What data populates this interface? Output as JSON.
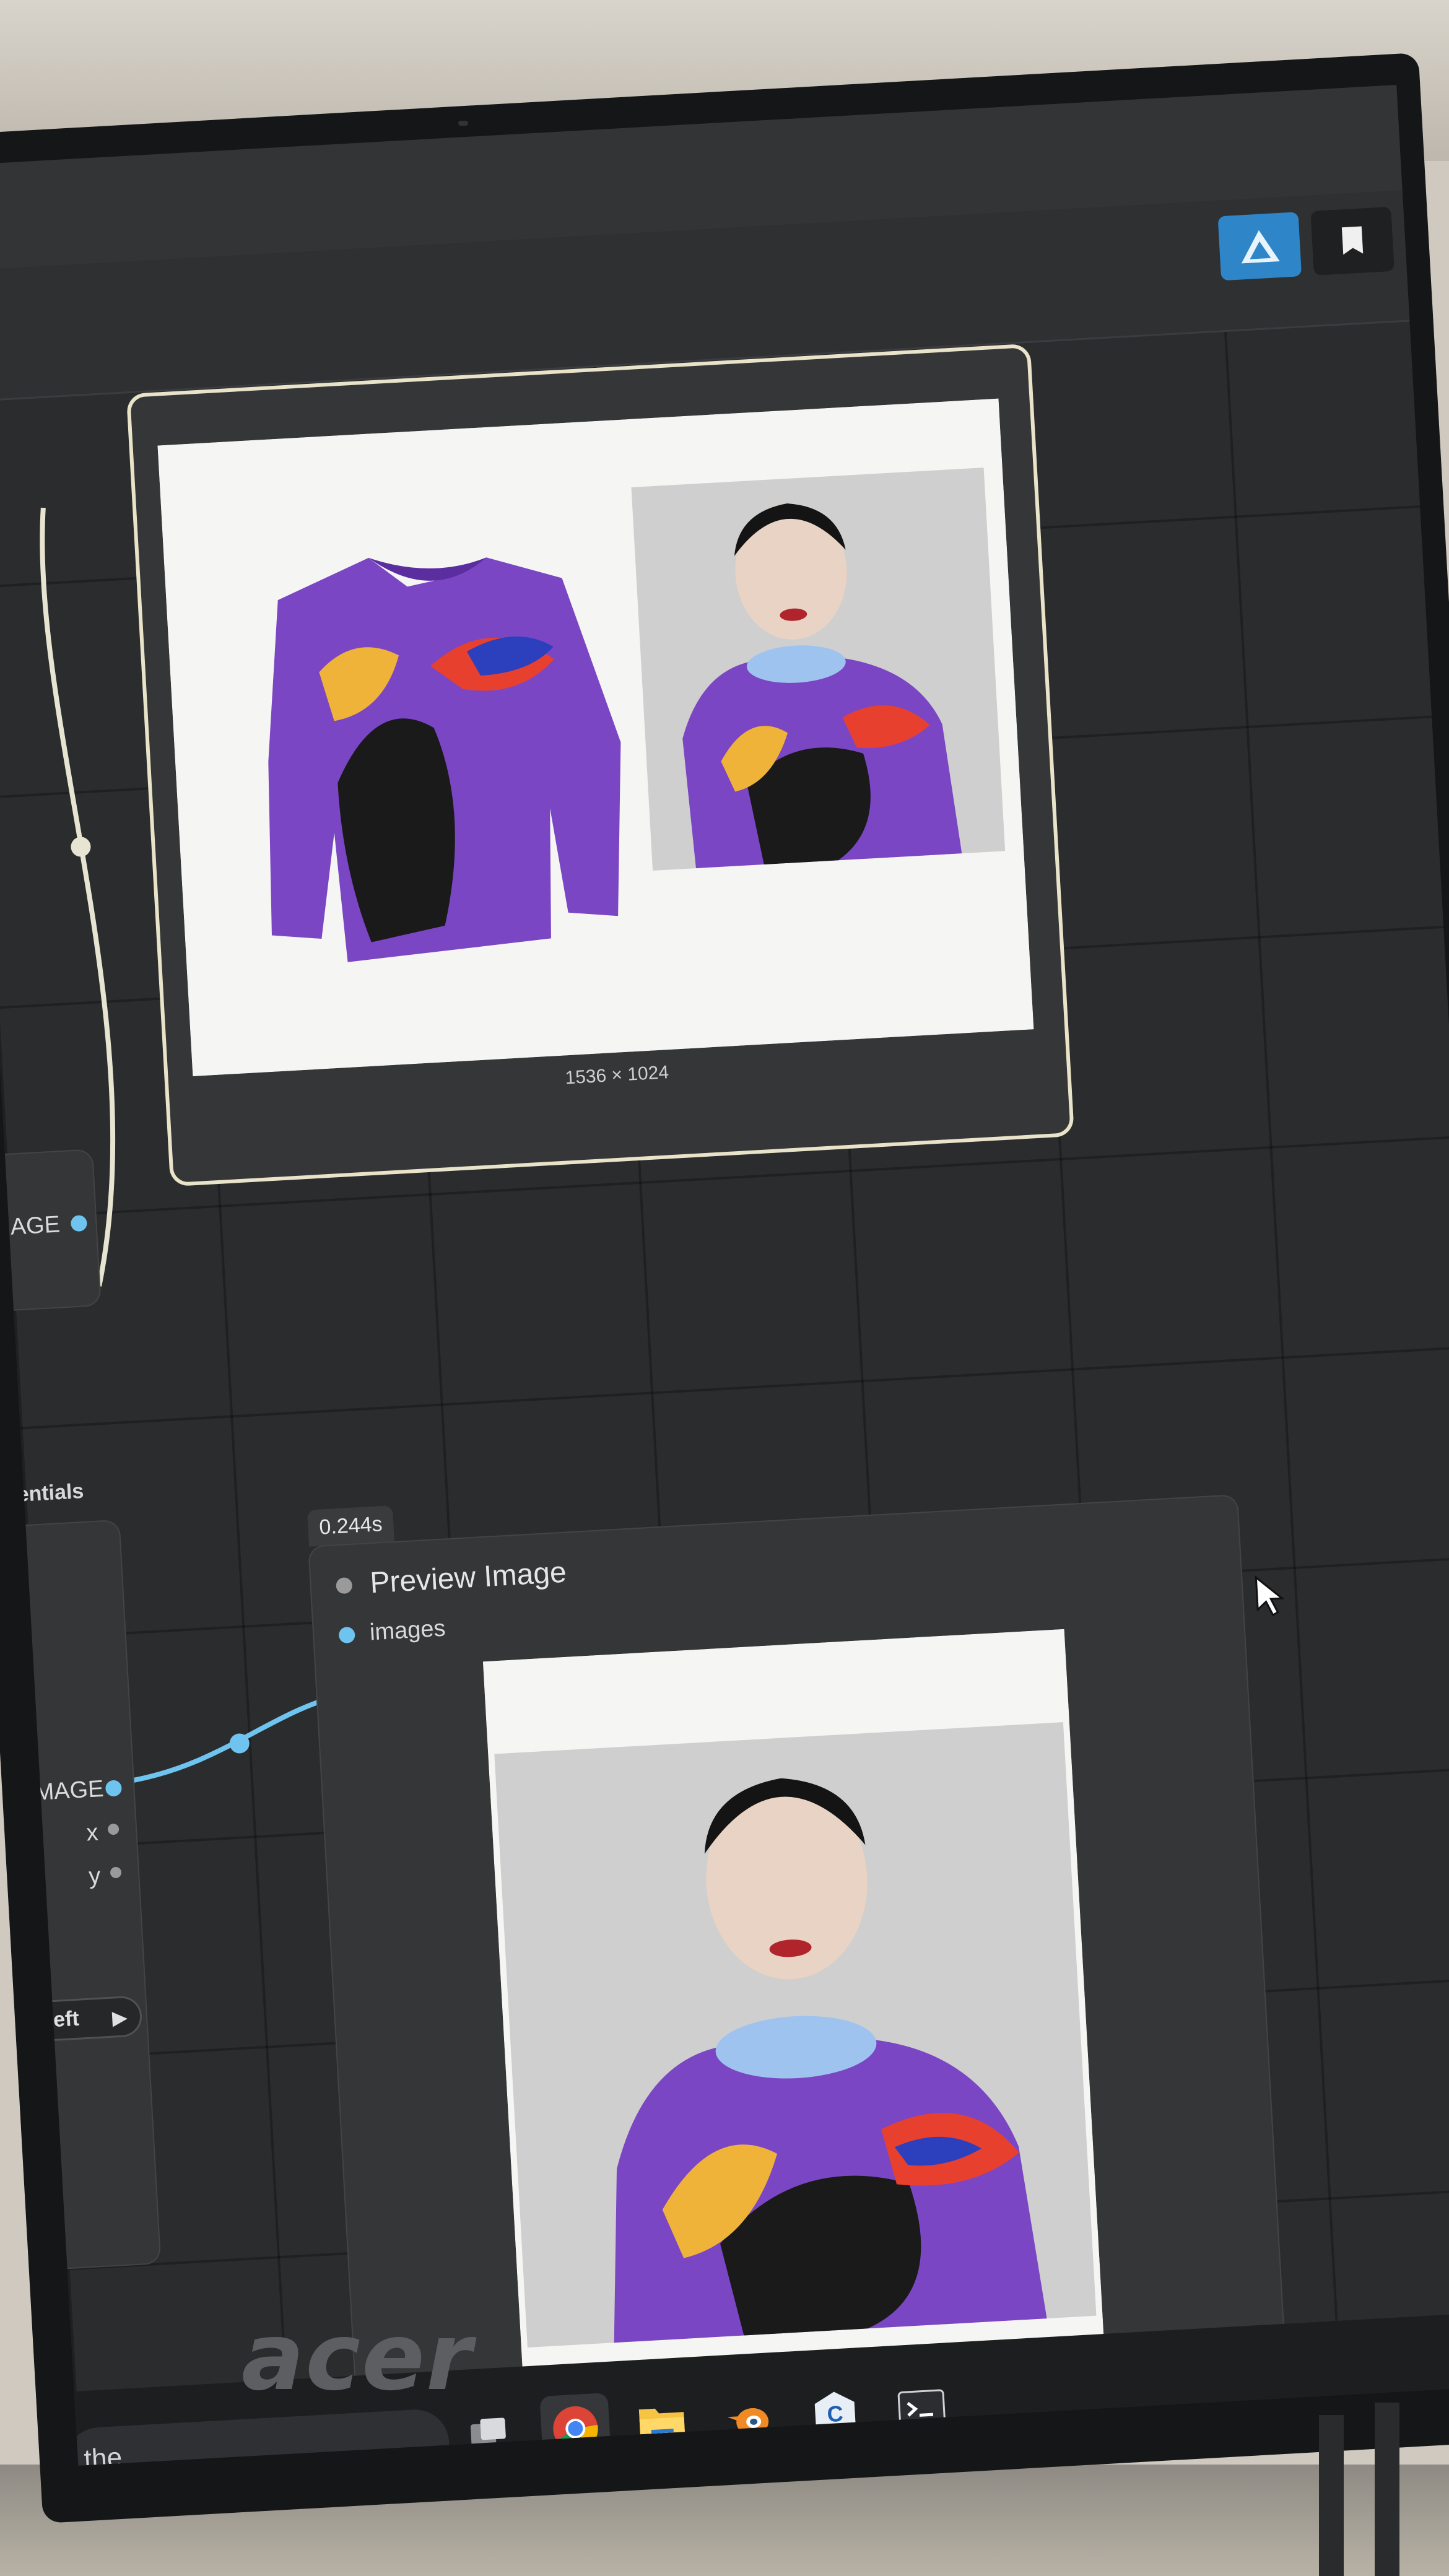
{
  "toolbar": {
    "primary_icon": "triangle-logo-icon",
    "secondary_icon": "bookmark-icon"
  },
  "load_node": {
    "output_label": "IMAGE"
  },
  "image_compare_node": {
    "dimensions": "1536 × 1024"
  },
  "essentials_node": {
    "title": "sentials",
    "outputs": [
      "MAGE",
      "x",
      "y"
    ],
    "button_label": "eft"
  },
  "preview_node": {
    "time_badge": "0.244s",
    "title": "Preview Image",
    "input_label": "images"
  },
  "taskbar": {
    "search_text": "the",
    "apps": [
      "task-view-icon",
      "chrome-icon",
      "file-explorer-icon",
      "blender-icon",
      "app-c-icon",
      "terminal-icon"
    ]
  },
  "monitor": {
    "brand": "acer"
  },
  "colors": {
    "accent_blue": "#2e86c9",
    "wire_blue": "#6fc4ef",
    "node_bg": "#353637",
    "canvas_bg": "#2b2c2e"
  }
}
